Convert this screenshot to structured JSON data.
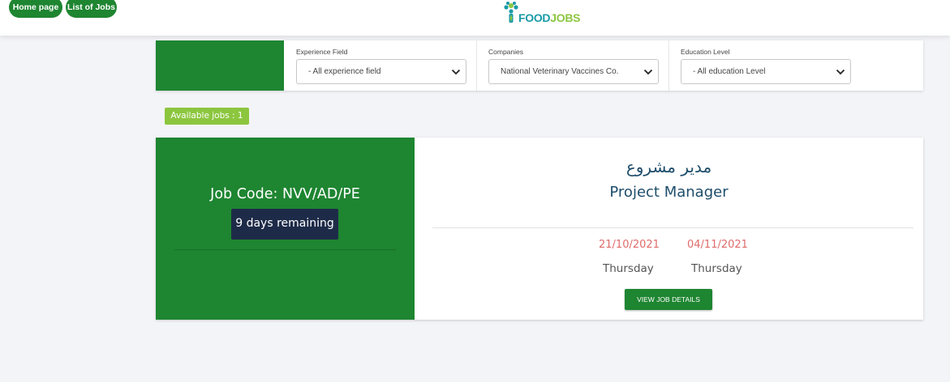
{
  "header": {
    "nav": [
      {
        "label": "Home page"
      },
      {
        "label": "List of Jobs"
      }
    ],
    "logo": {
      "part1": "FOOD",
      "part2": "JOBS",
      "icon": "tree-person-icon"
    }
  },
  "filters": {
    "experience": {
      "label": "Experience Field",
      "value": "- All experience field"
    },
    "companies": {
      "label": "Companies",
      "value": "National Veterinary Vaccines Co."
    },
    "education": {
      "label": "Education Level",
      "value": "- All education Level"
    }
  },
  "available_jobs": "Available jobs : 1",
  "job": {
    "code": "Job Code: NVV/AD/PE",
    "remaining": "9 days remaining",
    "title_ar": "مدير مشروع",
    "title_en": "Project Manager",
    "start_date": "21/10/2021",
    "start_day": "Thursday",
    "end_date": "04/11/2021",
    "end_day": "Thursday",
    "details_button": "VIEW JOB DETAILS"
  },
  "colors": {
    "brand_green": "#1e8531",
    "accent_lime": "#8cc63f",
    "navy": "#1d2b48",
    "date_red": "#e06b6b",
    "title_blue": "#1e4d6b"
  }
}
